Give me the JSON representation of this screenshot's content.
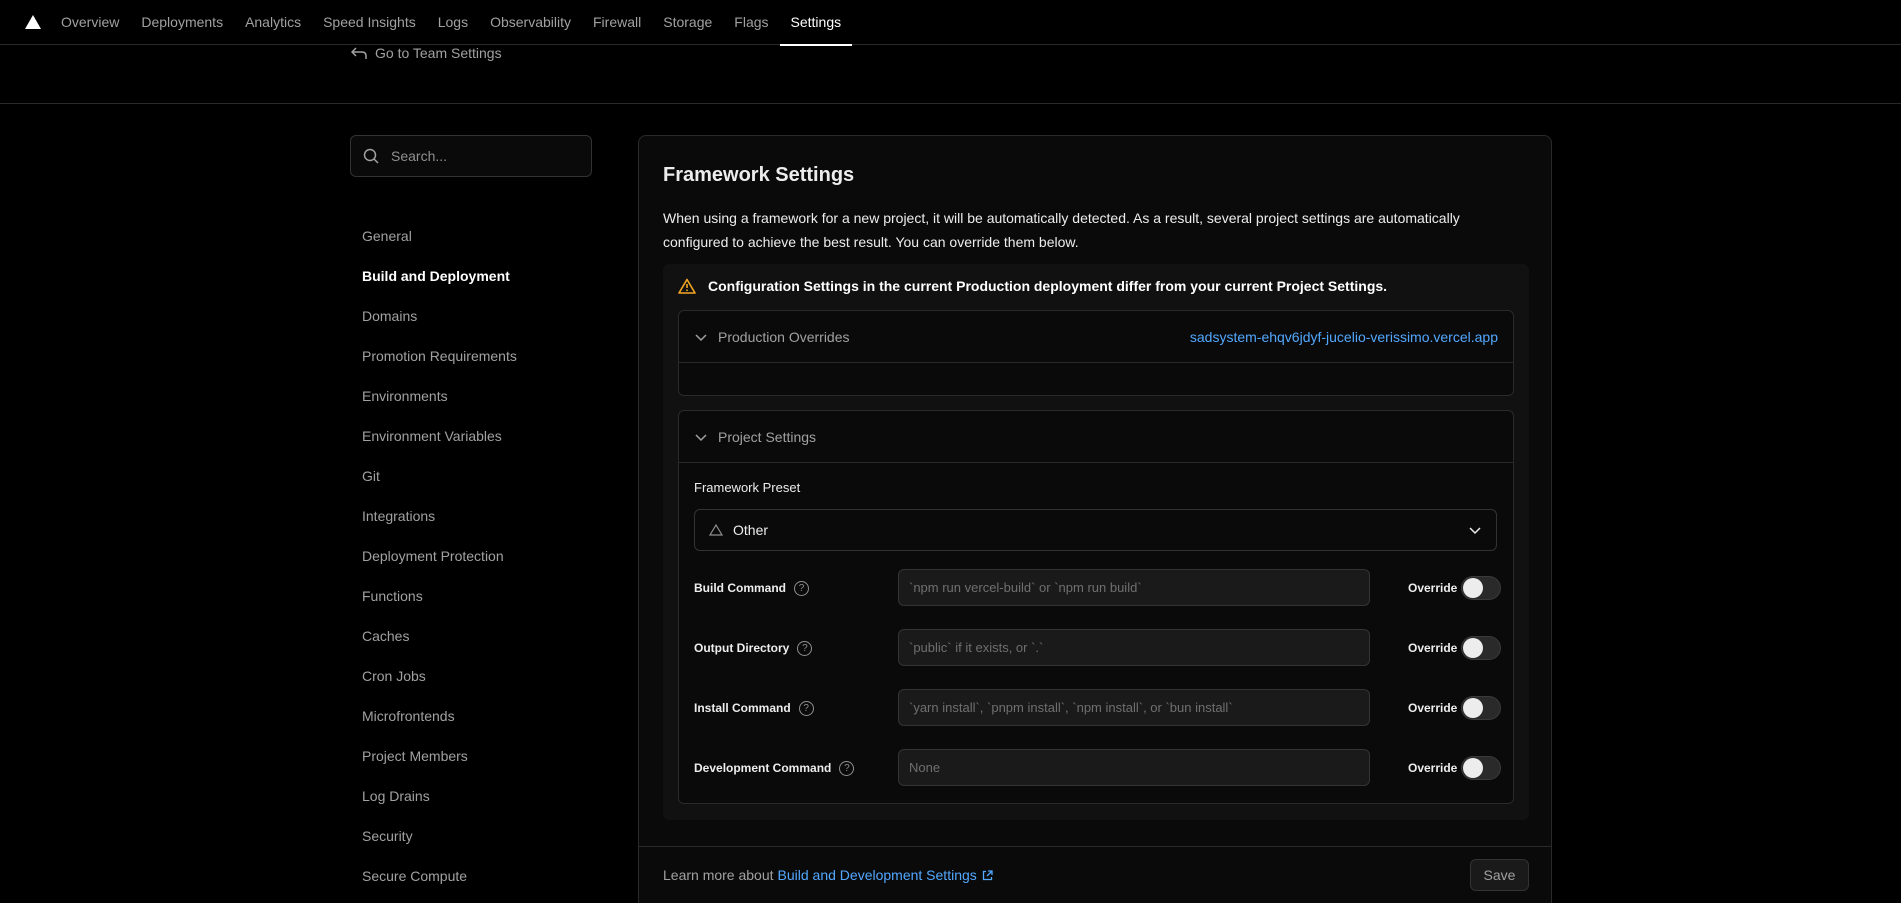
{
  "nav": {
    "logo_icon": "vercel-triangle-icon",
    "tabs": [
      {
        "label": "Overview",
        "active": false
      },
      {
        "label": "Deployments",
        "active": false
      },
      {
        "label": "Analytics",
        "active": false
      },
      {
        "label": "Speed Insights",
        "active": false
      },
      {
        "label": "Logs",
        "active": false
      },
      {
        "label": "Observability",
        "active": false
      },
      {
        "label": "Firewall",
        "active": false
      },
      {
        "label": "Storage",
        "active": false
      },
      {
        "label": "Flags",
        "active": false
      },
      {
        "label": "Settings",
        "active": true
      }
    ]
  },
  "header": {
    "back_label": "Go to Team Settings"
  },
  "sidebar": {
    "search_placeholder": "Search...",
    "items": [
      {
        "label": "General"
      },
      {
        "label": "Build and Deployment",
        "active": true
      },
      {
        "label": "Domains"
      },
      {
        "label": "Promotion Requirements"
      },
      {
        "label": "Environments"
      },
      {
        "label": "Environment Variables"
      },
      {
        "label": "Git"
      },
      {
        "label": "Integrations"
      },
      {
        "label": "Deployment Protection"
      },
      {
        "label": "Functions"
      },
      {
        "label": "Caches"
      },
      {
        "label": "Cron Jobs"
      },
      {
        "label": "Microfrontends"
      },
      {
        "label": "Project Members"
      },
      {
        "label": "Log Drains"
      },
      {
        "label": "Security"
      },
      {
        "label": "Secure Compute"
      }
    ]
  },
  "main": {
    "title": "Framework Settings",
    "description": "When using a framework for a new project, it will be automatically detected. As a result, several project settings are automatically configured to achieve the best result. You can override them below.",
    "warning": "Configuration Settings in the current Production deployment differ from your current Project Settings.",
    "production_overrides": {
      "label": "Production Overrides",
      "deployment_url": "sadsystem-ehqv6jdyf-jucelio-verissimo.vercel.app"
    },
    "project_settings": {
      "label": "Project Settings",
      "framework_preset_label": "Framework Preset",
      "framework_preset_value": "Other",
      "fields": [
        {
          "label": "Build Command",
          "placeholder": "`npm run vercel-build` or `npm run build`",
          "override_label": "Override",
          "override": false
        },
        {
          "label": "Output Directory",
          "placeholder": "`public` if it exists, or `.`",
          "override_label": "Override",
          "override": false
        },
        {
          "label": "Install Command",
          "placeholder": "`yarn install`, `pnpm install`, `npm install`, or `bun install`",
          "override_label": "Override",
          "override": false
        },
        {
          "label": "Development Command",
          "placeholder": "None",
          "override_label": "Override",
          "override": false
        }
      ]
    },
    "footer": {
      "text": "Learn more about",
      "link": "Build and Development Settings",
      "save_label": "Save"
    }
  },
  "colors": {
    "background": "#000000",
    "link": "#52a8ff",
    "warning": "#f5a623"
  }
}
